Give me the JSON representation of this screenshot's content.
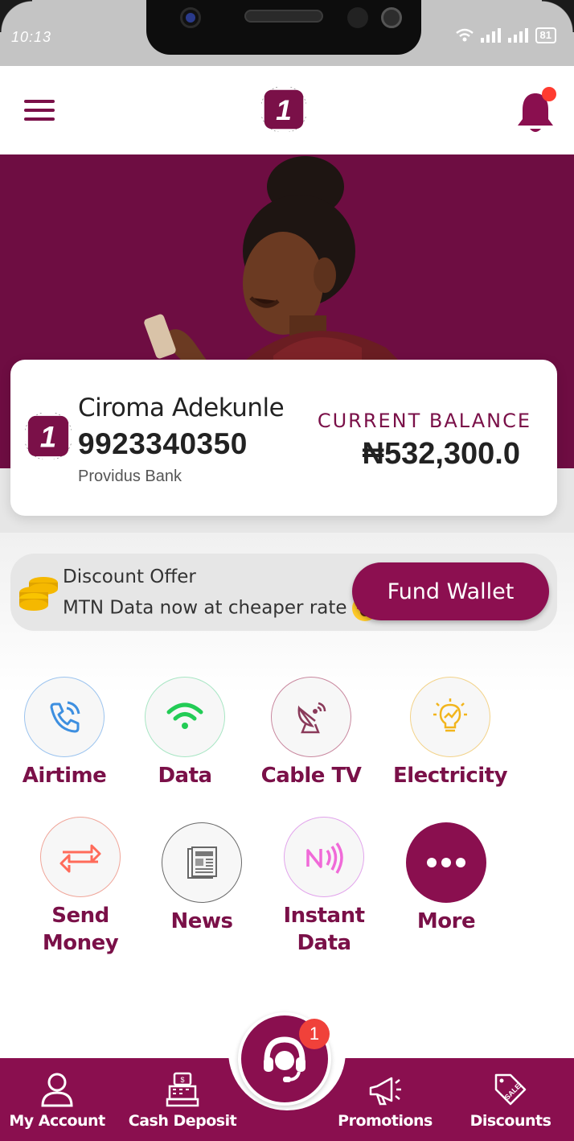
{
  "status_bar": {
    "time": "10:13",
    "battery": "81"
  },
  "header": {
    "logo_text": "1",
    "notification_dot": true
  },
  "account": {
    "name": "Ciroma Adekunle",
    "number": "9923340350",
    "bank": "Providus Bank",
    "balance_label": "CURRENT BALANCE",
    "balance_value": "₦532,300.0"
  },
  "promo": {
    "title": "Discount Offer",
    "subtitle": "MTN Data now at cheaper rate",
    "fund_wallet_label": "Fund Wallet"
  },
  "services": [
    {
      "label": "Airtime",
      "icon": "phone-call-icon"
    },
    {
      "label": "Data",
      "icon": "wifi-icon"
    },
    {
      "label": "Cable TV",
      "icon": "satellite-dish-icon"
    },
    {
      "label": "Electricity",
      "icon": "lightbulb-icon"
    },
    {
      "label": "Send\nMoney",
      "line1": "Send",
      "line2": "Money",
      "icon": "transfer-arrows-icon"
    },
    {
      "label": "News",
      "icon": "newspaper-icon"
    },
    {
      "label": "Instant\nData",
      "line1": "Instant",
      "line2": "Data",
      "icon": "nfc-signal-icon"
    },
    {
      "label": "More",
      "icon": "more-dots-icon"
    }
  ],
  "bottom_nav": {
    "items": [
      {
        "label": "My Account",
        "icon": "user-icon"
      },
      {
        "label": "Cash Deposit",
        "icon": "cash-register-icon"
      },
      {
        "label": "Promotions",
        "icon": "megaphone-icon"
      },
      {
        "label": "Discounts",
        "icon": "sale-tag-icon"
      }
    ],
    "support_badge": "1"
  },
  "colors": {
    "brand": "#8a0f4f",
    "brand_dark": "#6e0d42",
    "badge": "#f0413a"
  }
}
